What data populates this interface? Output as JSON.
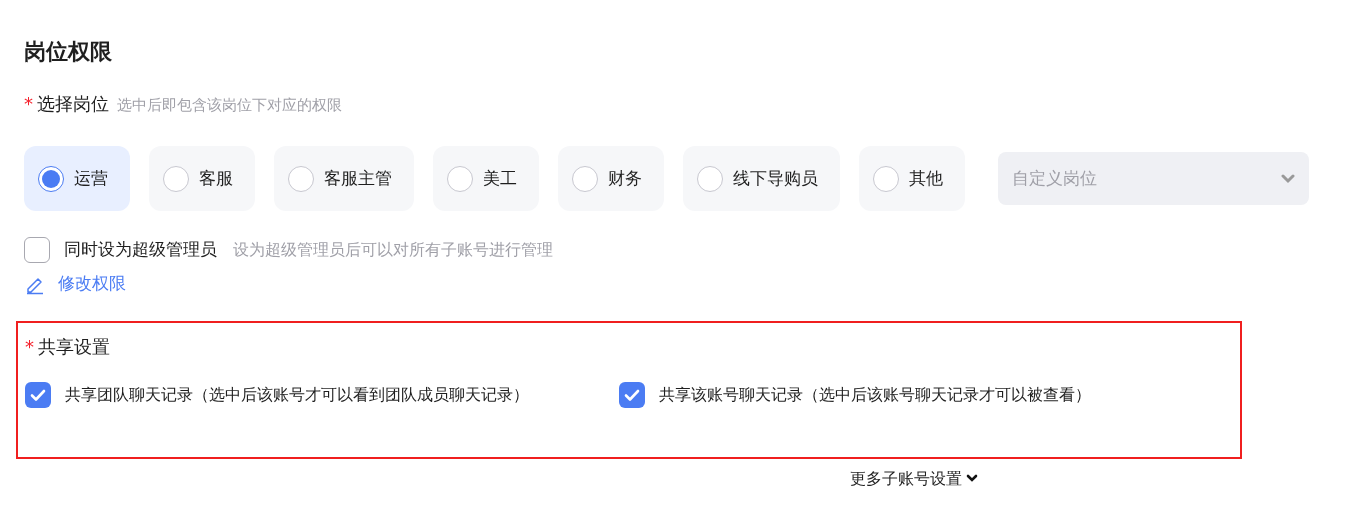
{
  "title": "岗位权限",
  "position": {
    "required_mark": "*",
    "label": "选择岗位",
    "hint": "选中后即包含该岗位下对应的权限",
    "options": [
      {
        "label": "运营",
        "selected": true
      },
      {
        "label": "客服",
        "selected": false
      },
      {
        "label": "客服主管",
        "selected": false
      },
      {
        "label": "美工",
        "selected": false
      },
      {
        "label": "财务",
        "selected": false
      },
      {
        "label": "线下导购员",
        "selected": false
      },
      {
        "label": "其他",
        "selected": false
      }
    ],
    "custom_select": {
      "placeholder": "自定义岗位"
    }
  },
  "super_admin": {
    "label": "同时设为超级管理员",
    "hint": "设为超级管理员后可以对所有子账号进行管理",
    "checked": false
  },
  "edit_link": "修改权限",
  "sharing": {
    "required_mark": "*",
    "label": "共享设置",
    "options": [
      {
        "label": "共享团队聊天记录（选中后该账号才可以看到团队成员聊天记录）",
        "checked": true
      },
      {
        "label": "共享该账号聊天记录（选中后该账号聊天记录才可以被查看）",
        "checked": true
      }
    ]
  },
  "more_link": "更多子账号设置"
}
